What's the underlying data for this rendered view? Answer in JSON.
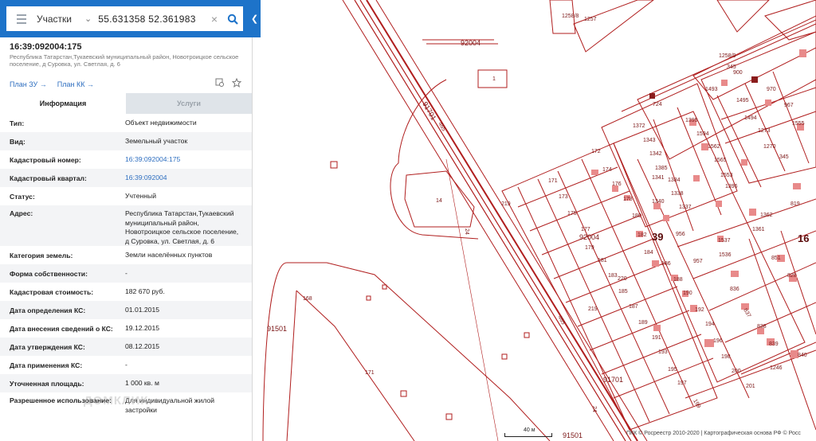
{
  "search": {
    "type_label": "Участки",
    "query": "55.631358 52.361983"
  },
  "object": {
    "cadastral_number": "16:39:092004:175",
    "address_short": "Республика Татарстан,Тукаевский муниципальный район, Новотроицкое сельское поселение, д Суровка, ул. Светлая, д. 6"
  },
  "plan_links": [
    "План ЗУ →",
    "План КК →"
  ],
  "tabs": [
    "Информация",
    "Услуги"
  ],
  "info_rows": [
    {
      "label": "Тип:",
      "value": "Объект недвижимости"
    },
    {
      "label": "Вид:",
      "value": "Земельный участок"
    },
    {
      "label": "Кадастровый номер:",
      "value": "16:39:092004:175"
    },
    {
      "label": "Кадастровый квартал:",
      "value": "16:39:092004"
    },
    {
      "label": "Статус:",
      "value": "Учтенный"
    },
    {
      "label": "Адрес:",
      "value": "Республика Татарстан,Тукаевский муниципальный район, Новотроицкое сельское поселение, д Суровка, ул. Светлая, д. 6"
    },
    {
      "label": "Категория земель:",
      "value": "Земли населённых пунктов"
    },
    {
      "label": "Форма собственности:",
      "value": "-"
    },
    {
      "label": "Кадастровая стоимость:",
      "value": "182 670 руб."
    },
    {
      "label": "Дата определения КС:",
      "value": "01.01.2015"
    },
    {
      "label": "Дата внесения сведений о КС:",
      "value": "19.12.2015"
    },
    {
      "label": "Дата утверждения КС:",
      "value": "08.12.2015"
    },
    {
      "label": "Дата применения КС:",
      "value": "-"
    },
    {
      "label": "Уточненная площадь:",
      "value": "1 000 кв. м"
    },
    {
      "label": "Разрешенное использование:",
      "value": "Для индивидуальной жилой застройки"
    }
  ],
  "map": {
    "labels": [
      "1258/8",
      "1257",
      "92004",
      "1258/9",
      "345",
      "900",
      "1493",
      "970",
      "1495",
      "967",
      "1",
      "724",
      "1372",
      "1395",
      "1494",
      "1555",
      "91701",
      "465",
      "1343",
      "1594",
      "1273",
      "1342",
      "1562",
      "1270",
      "345",
      "1385",
      "1565",
      "172",
      "174",
      "1384",
      "1553",
      "1341",
      "1338",
      "1396",
      "171",
      "176",
      "1337",
      "14",
      "219",
      "173",
      "178",
      "1340",
      "1362",
      "819",
      "175",
      "180",
      "1361",
      "177",
      "182",
      "39",
      "1537",
      "16",
      "92004",
      "956",
      "179",
      "184",
      "957",
      "1536",
      "851",
      "181",
      "186",
      "183",
      "220",
      "188",
      "836",
      "185",
      "190",
      "828",
      "187",
      "192",
      "837",
      "24",
      "219",
      "168",
      "189",
      "194",
      "91501",
      "465",
      "191",
      "196",
      "838",
      "193",
      "198",
      "839",
      "171",
      "195",
      "200",
      "1246",
      "840",
      "197",
      "201",
      "91701",
      "199",
      "24",
      "91501"
    ],
    "scale": "40 м",
    "copyright": "ПКК © Росреестр 2010-2020 | Картографическая основа РФ © Росс",
    "line_color": "#b01e1e",
    "building_color": "#e88a8a"
  },
  "watermark": "ДОМКЛИК"
}
